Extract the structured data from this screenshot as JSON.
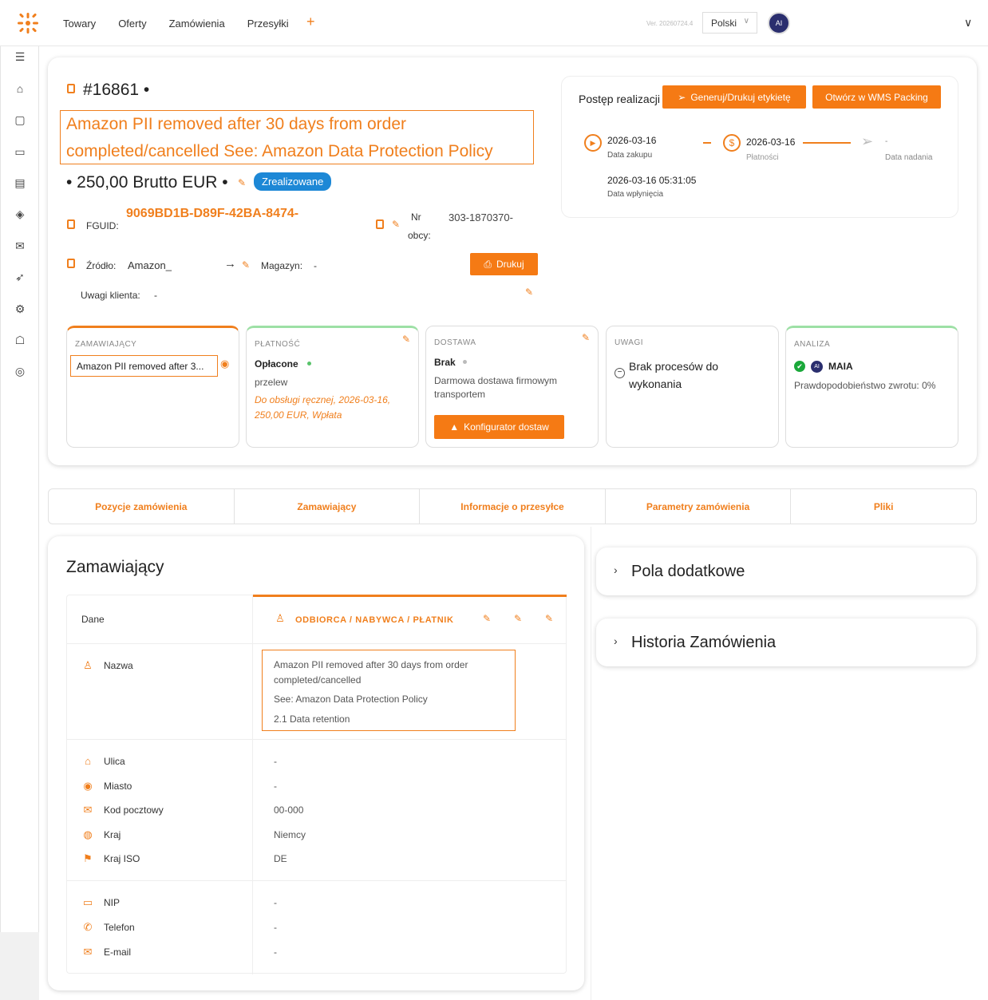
{
  "nav": {
    "items": [
      "Towary",
      "Oferty",
      "Zamówienia",
      "Przesyłki"
    ],
    "plus": "+"
  },
  "header": {
    "version": "Ver. 20260724.4",
    "language": "Polski",
    "avatar_text": "AI"
  },
  "order": {
    "number": "#16861 •",
    "pii_title": "Amazon PII removed after 30 days from order completed/cancelled See: Amazon Data Protection Policy",
    "brutto": "• 250,00 Brutto EUR •",
    "status": "Zrealizowane",
    "fguid_label": "FGUID:",
    "fguid_value": "9069BD1B-D89F-42BA-8474-",
    "nr_obcy_label_1": "Nr",
    "nr_obcy_label_2": "obcy:",
    "nr_obcy_value": "303-1870370-",
    "source_label": "Źródło:",
    "source_value": "Amazon_",
    "warehouse_label": "Magazyn:",
    "warehouse_value": "-",
    "print_label": "Drukuj",
    "notes_label": "Uwagi klienta:",
    "notes_value": "-"
  },
  "progress": {
    "title": "Postęp realizacji",
    "btn_label": "Generuj/Drukuj etykietę",
    "btn_wms": "Otwórz w WMS Packing",
    "purchase_date": "2026-03-16",
    "purchase_label": "Data zakupu",
    "payment_date": "2026-03-16",
    "payment_label": "Płatności",
    "ship_value": "-",
    "ship_label": "Data nadania",
    "inflow_date": "2026-03-16 05:31:05",
    "inflow_label": "Data wpłynięcia"
  },
  "cards": {
    "buyer": {
      "cap": "ZAMAWIAJĄCY",
      "name": "Amazon PII removed after 3..."
    },
    "payment": {
      "cap": "PŁATNOŚĆ",
      "status": "Opłacone",
      "method": "przelew",
      "note": "Do obsługi ręcznej, 2026-03-16, 250,00 EUR, Wpłata"
    },
    "delivery": {
      "cap": "DOSTAWA",
      "status": "Brak",
      "method": "Darmowa dostawa firmowym transportem",
      "btn": "Konfigurator dostaw"
    },
    "notes": {
      "cap": "UWAGI",
      "text": "Brak procesów do wykonania"
    },
    "analysis": {
      "cap": "ANALIZA",
      "name": "MAIA",
      "text": "Prawdopodobieństwo zwrotu: 0%"
    }
  },
  "tabs": [
    "Pozycje zamówienia",
    "Zamawiający",
    "Informacje o przesyłce",
    "Parametry zamówienia",
    "Pliki"
  ],
  "buyer_panel": {
    "title": "Zamawiający",
    "col_data": "Dane",
    "col_role": "ODBIORCA / NABYWCA / PŁATNIK",
    "name_label": "Nazwa",
    "name_lines": [
      "Amazon PII removed after 30 days from order",
      "completed/cancelled",
      "See: Amazon Data Protection Policy",
      "2.1 Data retention"
    ],
    "address": [
      {
        "label": "Ulica",
        "value": "-"
      },
      {
        "label": "Miasto",
        "value": "-"
      },
      {
        "label": "Kod pocztowy",
        "value": "00-000"
      },
      {
        "label": "Kraj",
        "value": "Niemcy"
      },
      {
        "label": "Kraj ISO",
        "value": "DE"
      }
    ],
    "contact": [
      {
        "label": "NIP",
        "value": "-"
      },
      {
        "label": "Telefon",
        "value": "-"
      },
      {
        "label": "E-mail",
        "value": "-"
      }
    ]
  },
  "side_panels": {
    "extra_fields": "Pola dodatkowe",
    "history": "Historia Zamówienia"
  },
  "colors": {
    "accent": "#f07f1d",
    "status_blue": "#1d88d6",
    "paid_green": "#58c36a"
  }
}
